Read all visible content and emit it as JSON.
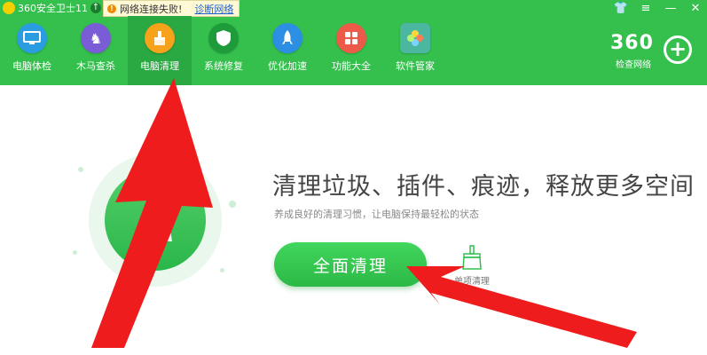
{
  "titlebar": {
    "app_title": "360安全卫士11",
    "warning_text": "网络连接失败!",
    "diagnose_link": "诊断网络"
  },
  "nav": {
    "items": [
      {
        "label": "电脑体检",
        "icon": "monitor-icon",
        "color": "#2a9de0"
      },
      {
        "label": "木马查杀",
        "icon": "horse-icon",
        "color": "#7a5cd6"
      },
      {
        "label": "电脑清理",
        "icon": "broom-icon",
        "color": "#f7a21b"
      },
      {
        "label": "系统修复",
        "icon": "shield-icon",
        "color": "#1e9b3a"
      },
      {
        "label": "优化加速",
        "icon": "rocket-icon",
        "color": "#2d8fe3"
      },
      {
        "label": "功能大全",
        "icon": "grid-icon",
        "color": "#ee5a4a"
      },
      {
        "label": "软件管家",
        "icon": "flower-icon",
        "color": "#4bb7a0"
      }
    ],
    "active_index": 2
  },
  "brand": {
    "logo_text": "360",
    "subtitle": "检查网络"
  },
  "main": {
    "headline": "清理垃圾、插件、痕迹，释放更多空间",
    "subline": "养成良好的清理习惯，让电脑保持最轻松的状态",
    "clean_button": "全面清理",
    "quick_clean_label": "单项清理"
  },
  "colors": {
    "header_green": "#35c04e",
    "active_tab": "#2aa842",
    "arrow_red": "#ee1c1c"
  }
}
